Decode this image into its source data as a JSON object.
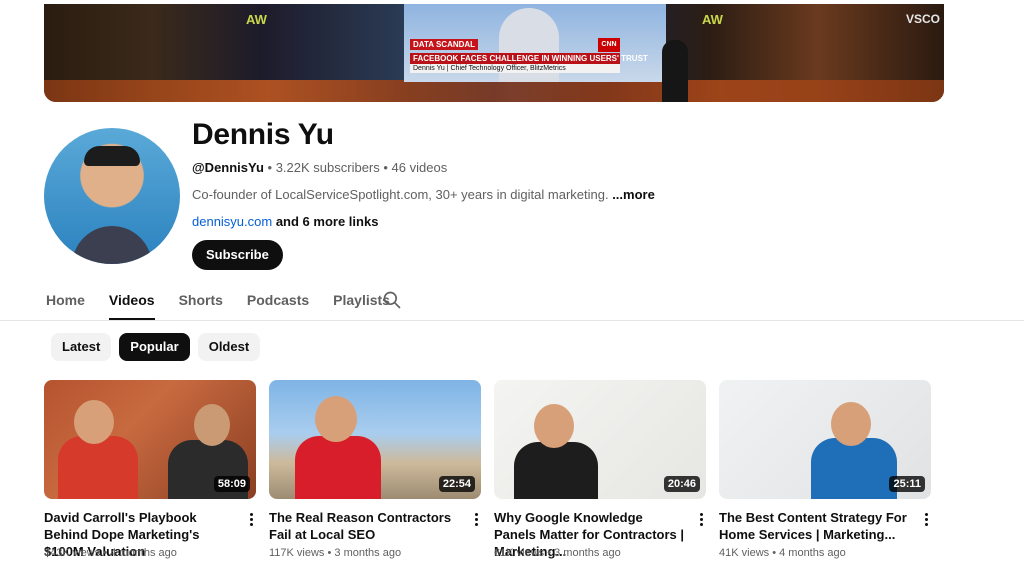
{
  "banner": {
    "ticker_tag": "DATA SCANDAL",
    "ticker_headline": "FACEBOOK FACES CHALLENGE IN WINNING USERS' TRUST",
    "ticker_sub": "Dennis Yu | Chief Technology Officer, BlitzMetrics",
    "network_logo": "CNN",
    "event_logo": "AW",
    "stage_text": "VSCO"
  },
  "channel": {
    "name": "Dennis Yu",
    "handle": "@DennisYu",
    "subscribers": "3.22K subscribers",
    "videos_count": "46 videos",
    "separator": " • ",
    "description": "Co-founder of LocalServiceSpotlight.com, 30+ years in digital marketing.",
    "more_label": " ...more",
    "link": "dennisyu.com",
    "more_links": " and 6 more links",
    "subscribe_label": "Subscribe"
  },
  "tabs": [
    {
      "label": "Home"
    },
    {
      "label": "Videos",
      "active": true
    },
    {
      "label": "Shorts"
    },
    {
      "label": "Podcasts"
    },
    {
      "label": "Playlists"
    }
  ],
  "filters": [
    {
      "label": "Latest"
    },
    {
      "label": "Popular",
      "active": true
    },
    {
      "label": "Oldest"
    }
  ],
  "videos": [
    {
      "title": "David Carroll's Playbook Behind Dope Marketing's $100M Valuation",
      "views": "343K views",
      "age": "4 months ago",
      "duration": "58:09"
    },
    {
      "title": "The Real Reason Contractors Fail at Local SEO",
      "views": "117K views",
      "age": "3 months ago",
      "duration": "22:54"
    },
    {
      "title": "Why Google Knowledge Panels Matter for Contractors | Marketing...",
      "views": "61K views",
      "age": "3 months ago",
      "duration": "20:46"
    },
    {
      "title": "The Best Content Strategy For Home Services | Marketing...",
      "views": "41K views",
      "age": "4 months ago",
      "duration": "25:11"
    }
  ],
  "meta_sep": " • "
}
